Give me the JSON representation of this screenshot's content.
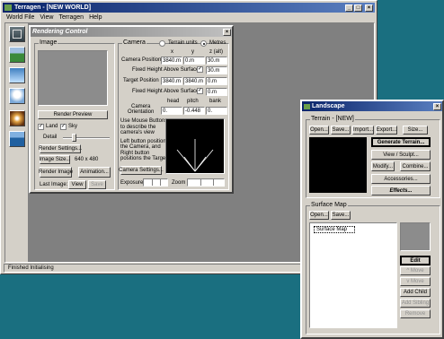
{
  "main_window": {
    "title": "Terragen - [NEW WORLD]",
    "menu": [
      "World File",
      "View",
      "Terragen",
      "Help"
    ],
    "status": "Finished Initialising"
  },
  "toolbar_icons": [
    "rendering-control-icon",
    "landscape-icon",
    "sky-icon",
    "cloud-icon",
    "lighting-icon",
    "water-icon"
  ],
  "render": {
    "title": "Rendering Control",
    "image_group": "Image",
    "preview_btn": "Render Preview",
    "land": "Land",
    "sky": "Sky",
    "land_checked": true,
    "sky_checked": true,
    "detail": "Detail",
    "settings_btn": "Render Settings...",
    "size_btn": "Image Size...",
    "size_value": "640 x 480",
    "render_image_btn": "Render Image",
    "animation_btn": "Animation...",
    "last_image": "Last Image:",
    "view_btn": "View",
    "save_btn": "Save",
    "camera_group": "Camera",
    "terrain_units": "Terrain units",
    "metres": "Metres",
    "col_x": "x",
    "col_y": "y",
    "col_z": "z (alt)",
    "camera_position": "Camera Position",
    "cam_x": "3840.m",
    "cam_y": "0.m",
    "cam_z": "30.m",
    "fixed_height_1": "Fixed Height Above Surface",
    "fixed_height_1_value": "30.m",
    "target_position": "Target Position",
    "tgt_x": "3840.m",
    "tgt_y": "3840.m",
    "tgt_z": "0.m",
    "fixed_height_2": "Fixed Height Above Surface",
    "fixed_height_2_value": "0.m",
    "col_head": "head",
    "col_pitch": "pitch",
    "col_bank": "bank",
    "camera_orientation_1": "Camera",
    "camera_orientation_2": "Orientation",
    "head": "0.",
    "pitch": "-0.448",
    "bank": "0.",
    "mouse_help_1": "Use Mouse Buttons",
    "mouse_help_2": "to describe the",
    "mouse_help_3": "camera's view",
    "mouse_help_4": "Left button positions",
    "mouse_help_5": "the Camera, and",
    "mouse_help_6": "Right button",
    "mouse_help_7": "positions the Target.",
    "camera_settings_btn": "Camera Settings...",
    "exposure": "Exposure",
    "zoom": "Zoom"
  },
  "landscape": {
    "title": "Landscape",
    "terrain_group": "Terrain - [NEW]",
    "open_btn": "Open...",
    "save_btn": "Save...",
    "import_btn": "Import...",
    "export_btn": "Export...",
    "size_btn": "Size...",
    "generate_btn": "Generate Terrain...",
    "view_sculpt_btn": "View / Sculpt...",
    "modify_btn": "Modify...",
    "combine_btn": "Combine...",
    "accessories_btn": "Accessories...",
    "effects_btn": "Effects...",
    "surface_group": "Surface Map",
    "surface_open_btn": "Open...",
    "surface_save_btn": "Save...",
    "surface_item": "Surface Map",
    "edit_btn": "Edit",
    "move_up_btn": "^ Move",
    "move_down_btn": "v Move",
    "add_child_btn": "Add Child",
    "add_sibling_btn": "Add Sibling",
    "remove_btn": "Remove"
  }
}
